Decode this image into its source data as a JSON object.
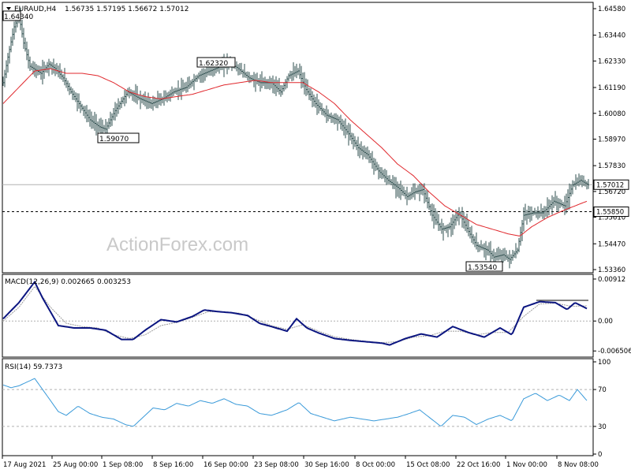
{
  "header": {
    "symbol_label": "EURAUD,H4",
    "ohlc": "1.56735 1.57195 1.56672 1.57012"
  },
  "watermark": "ActionForex.com",
  "colors": {
    "price": "#2f4f4f",
    "ma": "#e0282d",
    "macd": "#0b1580",
    "signal": "#9a9a9a",
    "rsi": "#3a9ad9",
    "grid": "#b0b0b0"
  },
  "price_panel": {
    "y_ticks": [
      "1.64580",
      "1.63440",
      "1.62330",
      "1.61190",
      "1.60080",
      "1.58970",
      "1.57830",
      "1.56720",
      "1.55610",
      "1.54470",
      "1.53360"
    ],
    "current_price_label": "1.57012",
    "support_label": "1.55850",
    "annotations": {
      "top_left": "1.64340",
      "a1": "1.59070",
      "a2": "1.62320",
      "a3": "1.53540"
    }
  },
  "macd_panel": {
    "label": "MACD(12,26,9) 0.002665 0.003253",
    "y_ticks": [
      "0.00912",
      "0.00",
      "-0.006506"
    ]
  },
  "rsi_panel": {
    "label": "RSI(14) 59.7373",
    "y_ticks": [
      "100",
      "70",
      "30",
      "0"
    ]
  },
  "x_axis": {
    "labels": [
      "17 Aug 2021",
      "25 Aug 00:00",
      "1 Sep 08:00",
      "8 Sep 16:00",
      "16 Sep 00:00",
      "23 Sep 08:00",
      "30 Sep 16:00",
      "8 Oct 00:00",
      "15 Oct 08:00",
      "22 Oct 16:00",
      "1 Nov 00:00",
      "8 Nov 08:00"
    ]
  },
  "chart_data": {
    "type": "line",
    "price_anchors": [
      [
        0,
        1.614
      ],
      [
        6,
        1.625
      ],
      [
        14,
        1.638
      ],
      [
        20,
        1.643
      ],
      [
        26,
        1.631
      ],
      [
        34,
        1.621
      ],
      [
        48,
        1.618
      ],
      [
        58,
        1.622
      ],
      [
        66,
        1.62
      ],
      [
        76,
        1.616
      ],
      [
        86,
        1.61
      ],
      [
        98,
        1.604
      ],
      [
        110,
        1.598
      ],
      [
        122,
        1.595
      ],
      [
        130,
        1.594
      ],
      [
        142,
        1.602
      ],
      [
        158,
        1.61
      ],
      [
        174,
        1.607
      ],
      [
        188,
        1.605
      ],
      [
        202,
        1.607
      ],
      [
        216,
        1.61
      ],
      [
        232,
        1.612
      ],
      [
        248,
        1.617
      ],
      [
        262,
        1.619
      ],
      [
        276,
        1.621
      ],
      [
        286,
        1.623
      ],
      [
        298,
        1.62
      ],
      [
        312,
        1.616
      ],
      [
        326,
        1.614
      ],
      [
        340,
        1.614
      ],
      [
        352,
        1.61
      ],
      [
        362,
        1.617
      ],
      [
        374,
        1.619
      ],
      [
        384,
        1.611
      ],
      [
        396,
        1.605
      ],
      [
        410,
        1.6
      ],
      [
        424,
        1.598
      ],
      [
        438,
        1.592
      ],
      [
        450,
        1.586
      ],
      [
        462,
        1.583
      ],
      [
        476,
        1.576
      ],
      [
        488,
        1.572
      ],
      [
        500,
        1.569
      ],
      [
        512,
        1.565
      ],
      [
        522,
        1.567
      ],
      [
        532,
        1.568
      ],
      [
        544,
        1.557
      ],
      [
        556,
        1.551
      ],
      [
        566,
        1.552
      ],
      [
        578,
        1.558
      ],
      [
        590,
        1.55
      ],
      [
        600,
        1.544
      ],
      [
        614,
        1.542
      ],
      [
        622,
        1.539
      ],
      [
        634,
        1.54
      ],
      [
        642,
        1.538
      ],
      [
        652,
        1.542
      ],
      [
        660,
        1.557
      ],
      [
        672,
        1.558
      ],
      [
        684,
        1.558
      ],
      [
        698,
        1.563
      ],
      [
        712,
        1.561
      ],
      [
        722,
        1.57
      ],
      [
        732,
        1.572
      ],
      [
        742,
        1.57
      ]
    ],
    "ma_anchors": [
      [
        0,
        1.605
      ],
      [
        20,
        1.612
      ],
      [
        40,
        1.619
      ],
      [
        60,
        1.62
      ],
      [
        80,
        1.618
      ],
      [
        100,
        1.618
      ],
      [
        120,
        1.617
      ],
      [
        140,
        1.614
      ],
      [
        160,
        1.61
      ],
      [
        180,
        1.608
      ],
      [
        200,
        1.607
      ],
      [
        220,
        1.608
      ],
      [
        240,
        1.609
      ],
      [
        260,
        1.611
      ],
      [
        280,
        1.613
      ],
      [
        300,
        1.614
      ],
      [
        320,
        1.615
      ],
      [
        340,
        1.614
      ],
      [
        360,
        1.614
      ],
      [
        380,
        1.614
      ],
      [
        400,
        1.61
      ],
      [
        420,
        1.605
      ],
      [
        440,
        1.598
      ],
      [
        460,
        1.592
      ],
      [
        480,
        1.586
      ],
      [
        500,
        1.579
      ],
      [
        520,
        1.574
      ],
      [
        540,
        1.567
      ],
      [
        560,
        1.561
      ],
      [
        580,
        1.557
      ],
      [
        600,
        1.553
      ],
      [
        620,
        1.551
      ],
      [
        640,
        1.549
      ],
      [
        655,
        1.548
      ],
      [
        670,
        1.552
      ],
      [
        690,
        1.556
      ],
      [
        710,
        1.559
      ],
      [
        725,
        1.561
      ],
      [
        740,
        1.563
      ]
    ],
    "macd_anchors": [
      [
        0,
        0.0005
      ],
      [
        20,
        0.004
      ],
      [
        40,
        0.0085
      ],
      [
        50,
        0.005
      ],
      [
        70,
        -0.001
      ],
      [
        90,
        -0.0015
      ],
      [
        110,
        -0.0015
      ],
      [
        130,
        -0.002
      ],
      [
        150,
        -0.004
      ],
      [
        165,
        -0.004
      ],
      [
        180,
        -0.002
      ],
      [
        200,
        0.0003
      ],
      [
        220,
        -0.0002
      ],
      [
        240,
        0.001
      ],
      [
        255,
        0.0024
      ],
      [
        275,
        0.002
      ],
      [
        290,
        0.0018
      ],
      [
        310,
        0.0012
      ],
      [
        325,
        -0.0005
      ],
      [
        340,
        -0.0012
      ],
      [
        360,
        -0.0022
      ],
      [
        372,
        0.0005
      ],
      [
        385,
        -0.0015
      ],
      [
        400,
        -0.0026
      ],
      [
        420,
        -0.0038
      ],
      [
        440,
        -0.0042
      ],
      [
        460,
        -0.0045
      ],
      [
        480,
        -0.0048
      ],
      [
        490,
        -0.0052
      ],
      [
        510,
        -0.0038
      ],
      [
        530,
        -0.0028
      ],
      [
        550,
        -0.0035
      ],
      [
        570,
        -0.0012
      ],
      [
        590,
        -0.0025
      ],
      [
        610,
        -0.0035
      ],
      [
        630,
        -0.0015
      ],
      [
        645,
        -0.003
      ],
      [
        660,
        0.003
      ],
      [
        680,
        0.0042
      ],
      [
        700,
        0.004
      ],
      [
        715,
        0.0025
      ],
      [
        725,
        0.004
      ],
      [
        740,
        0.0027
      ]
    ],
    "signal_anchors": [
      [
        0,
        0.0
      ],
      [
        20,
        0.003
      ],
      [
        40,
        0.0075
      ],
      [
        60,
        0.003
      ],
      [
        80,
        -0.0005
      ],
      [
        100,
        -0.0012
      ],
      [
        120,
        -0.0015
      ],
      [
        140,
        -0.003
      ],
      [
        160,
        -0.0038
      ],
      [
        180,
        -0.003
      ],
      [
        200,
        -0.001
      ],
      [
        220,
        -0.0003
      ],
      [
        240,
        0.0008
      ],
      [
        260,
        0.002
      ],
      [
        280,
        0.002
      ],
      [
        300,
        0.0017
      ],
      [
        320,
        0.0004
      ],
      [
        340,
        -0.001
      ],
      [
        360,
        -0.0018
      ],
      [
        380,
        -0.0008
      ],
      [
        400,
        -0.0022
      ],
      [
        420,
        -0.0034
      ],
      [
        440,
        -0.004
      ],
      [
        460,
        -0.0044
      ],
      [
        480,
        -0.0047
      ],
      [
        500,
        -0.0045
      ],
      [
        520,
        -0.0035
      ],
      [
        540,
        -0.0032
      ],
      [
        560,
        -0.0022
      ],
      [
        580,
        -0.0022
      ],
      [
        600,
        -0.003
      ],
      [
        620,
        -0.0025
      ],
      [
        640,
        -0.0025
      ],
      [
        660,
        0.001
      ],
      [
        680,
        0.0037
      ],
      [
        700,
        0.0039
      ],
      [
        720,
        0.0032
      ],
      [
        740,
        0.0033
      ]
    ],
    "rsi_anchors": [
      [
        0,
        75
      ],
      [
        10,
        72
      ],
      [
        20,
        74
      ],
      [
        30,
        78
      ],
      [
        40,
        82
      ],
      [
        50,
        70
      ],
      [
        60,
        58
      ],
      [
        70,
        46
      ],
      [
        80,
        42
      ],
      [
        95,
        52
      ],
      [
        110,
        44
      ],
      [
        125,
        40
      ],
      [
        140,
        38
      ],
      [
        155,
        32
      ],
      [
        165,
        30
      ],
      [
        175,
        38
      ],
      [
        190,
        50
      ],
      [
        205,
        48
      ],
      [
        220,
        55
      ],
      [
        235,
        52
      ],
      [
        250,
        58
      ],
      [
        265,
        55
      ],
      [
        280,
        60
      ],
      [
        295,
        54
      ],
      [
        310,
        52
      ],
      [
        325,
        44
      ],
      [
        340,
        42
      ],
      [
        360,
        48
      ],
      [
        375,
        56
      ],
      [
        390,
        44
      ],
      [
        405,
        40
      ],
      [
        420,
        36
      ],
      [
        440,
        40
      ],
      [
        455,
        38
      ],
      [
        470,
        36
      ],
      [
        485,
        38
      ],
      [
        500,
        40
      ],
      [
        515,
        44
      ],
      [
        528,
        48
      ],
      [
        540,
        40
      ],
      [
        555,
        30
      ],
      [
        570,
        42
      ],
      [
        585,
        40
      ],
      [
        600,
        32
      ],
      [
        615,
        38
      ],
      [
        630,
        42
      ],
      [
        645,
        36
      ],
      [
        660,
        60
      ],
      [
        675,
        66
      ],
      [
        690,
        58
      ],
      [
        705,
        64
      ],
      [
        718,
        58
      ],
      [
        728,
        70
      ],
      [
        740,
        58
      ]
    ],
    "current_price": 1.57012,
    "support": 1.5585,
    "price_ylim": [
      1.5336,
      1.6458
    ],
    "macd_ylim": [
      -0.0075,
      0.0098
    ],
    "rsi_ylim": [
      0,
      100
    ]
  }
}
